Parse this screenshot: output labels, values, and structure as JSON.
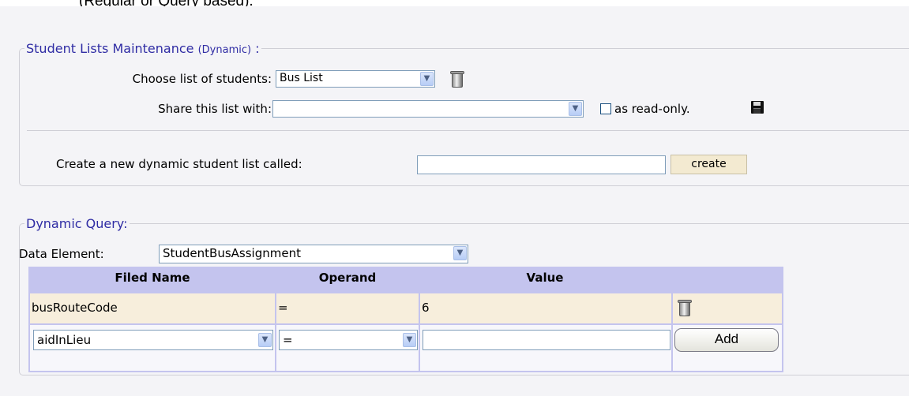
{
  "intro_text": "(Regular or Query based).",
  "maintenance": {
    "legend_main": "Student Lists Maintenance ",
    "legend_sub": "(Dynamic)",
    "legend_colon": " :",
    "choose_label": "Choose list of students:",
    "choose_value": "Bus List",
    "share_label": "Share this list with:",
    "share_value": "",
    "readonly_label": "as read-only.",
    "readonly_checked": false,
    "create_label": "Create a new dynamic student list called:",
    "create_value": "",
    "create_button": "create"
  },
  "query": {
    "legend": "Dynamic Query:",
    "data_element_label": "Data Element:",
    "data_element_value": "StudentBusAssignment",
    "columns": [
      "Filed Name",
      "Operand",
      "Value"
    ],
    "rows": [
      {
        "field": "busRouteCode",
        "operand": "=",
        "value": "6"
      }
    ],
    "new_row": {
      "field": "aidInLieu",
      "operand": "=",
      "value": ""
    },
    "add_button": "Add"
  },
  "icons": [
    "trash-icon",
    "save-icon",
    "chevron-down-icon"
  ],
  "colors": {
    "legend_text": "#2f2ca4",
    "table_border": "#c4c4ee",
    "data_row_bg": "#f7eedc",
    "panel_bg": "#f4f4f7"
  }
}
